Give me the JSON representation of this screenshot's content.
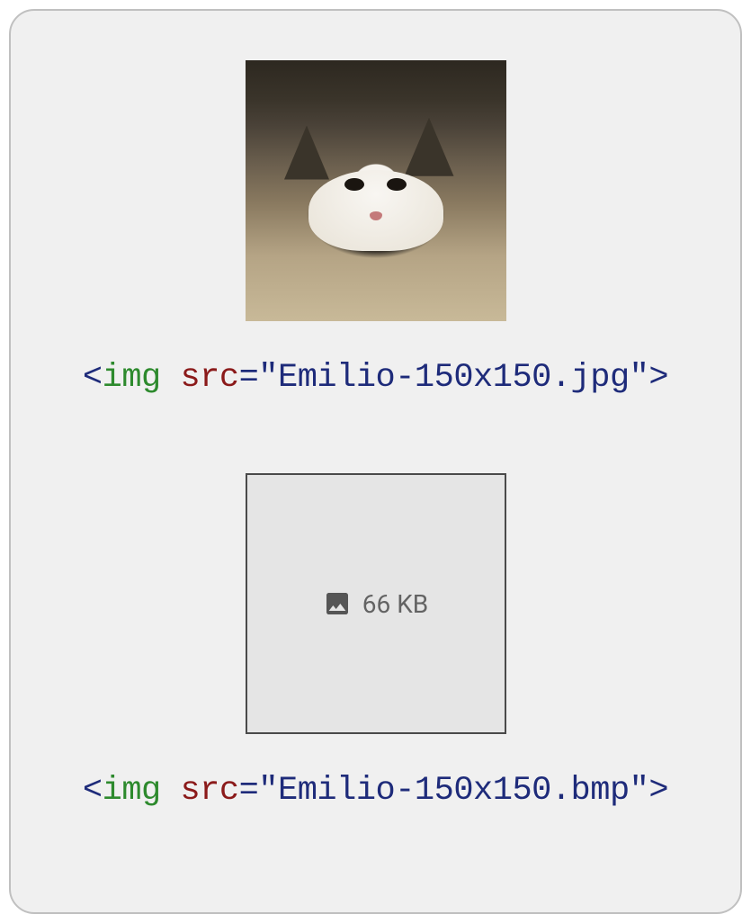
{
  "examples": [
    {
      "type": "photo",
      "code": {
        "open_bracket": "<",
        "tag": "img",
        "attr": "src",
        "equals": "=",
        "value": "\"Emilio-150x150.jpg\"",
        "close_bracket": ">"
      }
    },
    {
      "type": "placeholder",
      "placeholder_size": "66 KB",
      "code": {
        "open_bracket": "<",
        "tag": "img",
        "attr": "src",
        "equals": "=",
        "value": "\"Emilio-150x150.bmp\"",
        "close_bracket": ">"
      }
    }
  ]
}
